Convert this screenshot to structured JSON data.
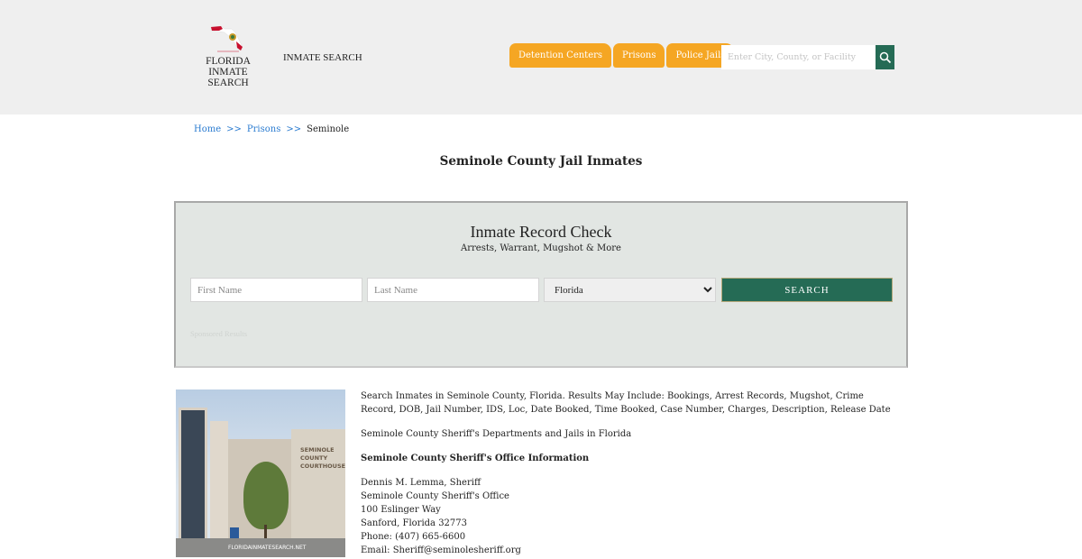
{
  "header": {
    "logo_text": [
      "FLORIDA",
      "INMATE SEARCH"
    ],
    "site_title": "INMATE SEARCH",
    "nav": [
      "Detention Centers",
      "Prisons",
      "Police Jails"
    ],
    "search_placeholder": "Enter City, County, or Facility"
  },
  "breadcrumb": {
    "items": [
      "Home",
      "Prisons"
    ],
    "separator": ">>",
    "current": "Seminole"
  },
  "page_title": "Seminole County Jail Inmates",
  "record_check": {
    "title": "Inmate Record Check",
    "subtitle": "Arrests, Warrant, Mugshot & More",
    "first_placeholder": "First Name",
    "last_placeholder": "Last Name",
    "state": "Florida",
    "button": "SEARCH",
    "sponsored": "Sponsored Results"
  },
  "photo": {
    "sign": [
      "SEMINOLE",
      "COUNTY",
      "COURTHOUSE"
    ],
    "watermark": "FLORIDAINMATESEARCH.NET"
  },
  "content": {
    "intro": "Search Inmates in Seminole County, Florida. Results May Include: Bookings, Arrest Records, Mugshot, Crime Record, DOB, Jail Number, IDS, Loc, Date Booked, Time Booked, Case Number, Charges, Description, Release Date",
    "departments": "Seminole County Sheriff's Departments and Jails in Florida",
    "office_heading": "Seminole County Sheriff's Office Information",
    "address": [
      "Dennis M. Lemma, Sheriff",
      "Seminole County Sheriff's Office",
      "100 Eslinger Way",
      "Sanford, Florida 32773",
      "Phone: (407) 665-6600",
      "Email: Sheriff@seminolesheriff.org"
    ]
  },
  "colors": {
    "accent": "#f5a623",
    "primary": "#256b55",
    "link": "#2a7bd0"
  }
}
